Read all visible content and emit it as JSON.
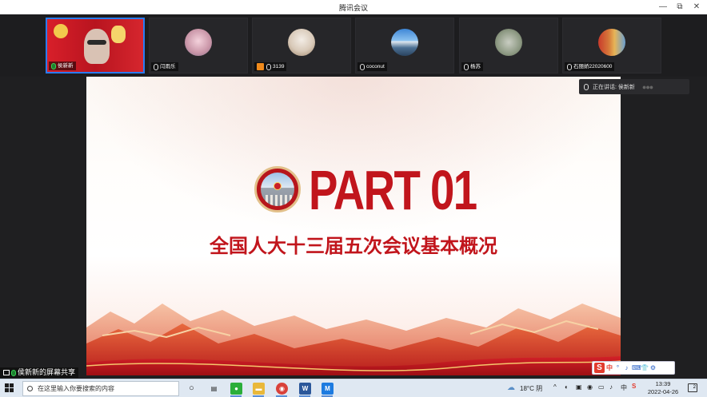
{
  "window": {
    "title": "腾讯会议",
    "controls": [
      "—",
      "⧉",
      "✕"
    ]
  },
  "participants": [
    {
      "name": "侯新新",
      "mic": "active",
      "active": true
    },
    {
      "name": "闫雨乐",
      "mic": "muted"
    },
    {
      "name": "3139",
      "mic": "muted",
      "badge": true
    },
    {
      "name": "coconut",
      "mic": "muted"
    },
    {
      "name": "杨苏",
      "mic": "muted"
    },
    {
      "name": "石丽娇22020600",
      "mic": "muted"
    }
  ],
  "speaking": {
    "label": "正在讲话: 侯新新",
    "dots": "●●●"
  },
  "slide": {
    "heading": "PART 01",
    "subtitle": "全国人大十三届五次会议基本概况"
  },
  "share_label": "侯新新的屏幕共享",
  "ime": {
    "logo": "S",
    "lang": "中",
    "items": [
      "°",
      "♪",
      "⌨",
      "👕",
      "⚙"
    ]
  },
  "taskbar": {
    "search_placeholder": "在这里输入你要搜索的内容",
    "apps": [
      {
        "name": "wechat",
        "color": "#2aae3a",
        "glyph": "●"
      },
      {
        "name": "file-explorer",
        "color": "#e9b83a",
        "glyph": "▬"
      },
      {
        "name": "chrome",
        "color": "#d9413a",
        "glyph": "◉"
      },
      {
        "name": "word",
        "color": "#2b579a",
        "glyph": "W"
      },
      {
        "name": "tencent-meeting",
        "color": "#1d7be0",
        "glyph": "M"
      }
    ],
    "weather": "18°C 阴",
    "time": "13:39",
    "date": "2022-04-26",
    "notification_count": "2"
  }
}
